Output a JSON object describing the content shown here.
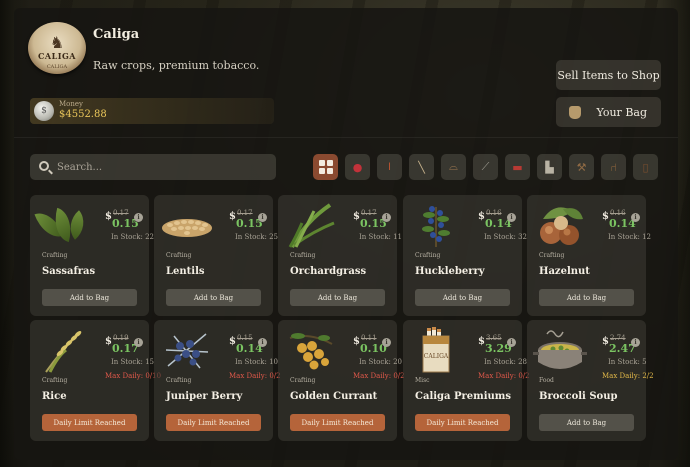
{
  "shop": {
    "logo_text": "CALIGA",
    "logo_band": "CALIGA",
    "name": "Caliga",
    "tagline": "Raw crops, premium tobacco."
  },
  "money": {
    "label": "Money",
    "value": "$4552.88"
  },
  "buttons": {
    "sell": "Sell Items to Shop",
    "bag": "Your Bag"
  },
  "search": {
    "placeholder": "Search..."
  },
  "categories": [
    {
      "icon": "grid-icon",
      "active": true
    },
    {
      "icon": "berry-icon"
    },
    {
      "icon": "torch-icon"
    },
    {
      "icon": "fishing-rod-icon"
    },
    {
      "icon": "hat-icon"
    },
    {
      "icon": "rifle-icon"
    },
    {
      "icon": "clothing-icon"
    },
    {
      "icon": "boots-icon"
    },
    {
      "icon": "tools-icon"
    },
    {
      "icon": "chair-icon"
    },
    {
      "icon": "lantern-icon"
    },
    {
      "icon": "coil-icon"
    }
  ],
  "items": [
    {
      "name": "Sassafras",
      "category": "Crafting",
      "old_price": "0.17",
      "price": "0.15",
      "stock": "In Stock: 22",
      "max_daily": "",
      "button": "Add to Bag",
      "limit": false,
      "icon": "sassafras-icon"
    },
    {
      "name": "Lentils",
      "category": "Crafting",
      "old_price": "0.17",
      "price": "0.15",
      "stock": "In Stock: 25",
      "max_daily": "",
      "button": "Add to Bag",
      "limit": false,
      "icon": "lentils-icon"
    },
    {
      "name": "Orchardgrass",
      "category": "Crafting",
      "old_price": "0.17",
      "price": "0.15",
      "stock": "In Stock: 11",
      "max_daily": "",
      "button": "Add to Bag",
      "limit": false,
      "icon": "orchardgrass-icon"
    },
    {
      "name": "Huckleberry",
      "category": "Crafting",
      "old_price": "0.16",
      "price": "0.14",
      "stock": "In Stock: 32",
      "max_daily": "",
      "button": "Add to Bag",
      "limit": false,
      "icon": "huckleberry-icon"
    },
    {
      "name": "Hazelnut",
      "category": "Crafting",
      "old_price": "0.16",
      "price": "0.14",
      "stock": "In Stock: 12",
      "max_daily": "",
      "button": "Add to Bag",
      "limit": false,
      "icon": "hazelnut-icon"
    },
    {
      "name": "Rice",
      "category": "Crafting",
      "old_price": "0.19",
      "price": "0.17",
      "stock": "In Stock: 15",
      "max_daily": "Max Daily: 0/10",
      "button": "Daily Limit Reached",
      "limit": true,
      "icon": "rice-icon"
    },
    {
      "name": "Juniper Berry",
      "category": "Crafting",
      "old_price": "0.15",
      "price": "0.14",
      "stock": "In Stock: 10",
      "max_daily": "Max Daily: 0/2",
      "button": "Daily Limit Reached",
      "limit": true,
      "icon": "juniper-berry-icon"
    },
    {
      "name": "Golden Currant",
      "category": "Crafting",
      "old_price": "0.11",
      "price": "0.10",
      "stock": "In Stock: 20",
      "max_daily": "Max Daily: 0/2",
      "button": "Daily Limit Reached",
      "limit": true,
      "icon": "golden-currant-icon"
    },
    {
      "name": "Caliga Premiums",
      "category": "Misc",
      "old_price": "3.65",
      "price": "3.29",
      "stock": "In Stock: 28",
      "max_daily": "Max Daily: 0/2",
      "button": "Daily Limit Reached",
      "limit": true,
      "icon": "cigarette-pack-icon"
    },
    {
      "name": "Broccoli Soup",
      "category": "Food",
      "old_price": "2.74",
      "price": "2.47",
      "stock": "In Stock: 5",
      "max_daily": "Max Daily: 2/2",
      "button": "Add to Bag",
      "limit": false,
      "icon": "soup-pot-icon"
    }
  ],
  "colors": {
    "price_green": "#7bc462",
    "limit_button": "#b5643a",
    "max_daily_red": "#e0584a",
    "max_daily_gold": "#e2b848",
    "money_gold": "#e8c55a",
    "active_tab": "#8a4a30"
  }
}
